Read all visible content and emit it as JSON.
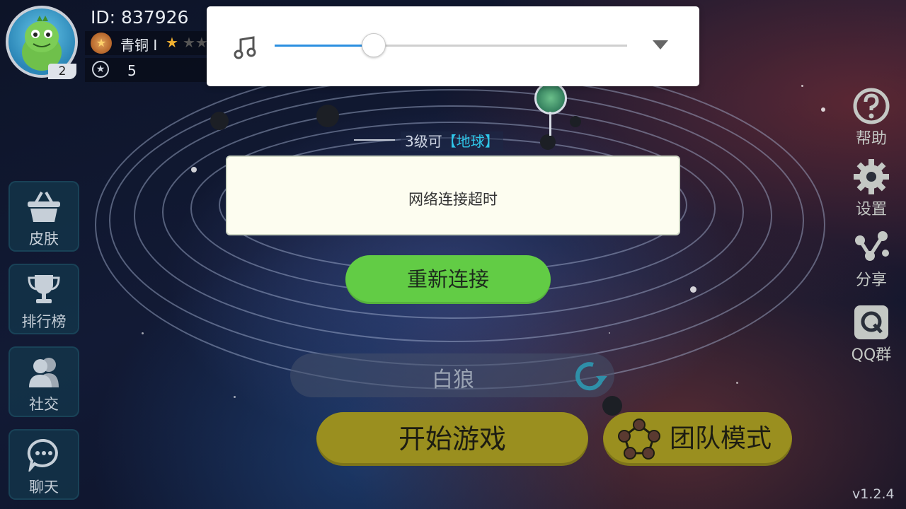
{
  "profile": {
    "id_text": "ID: 837926",
    "level_badge": "2",
    "rank_text": "青铜 I",
    "score": "5"
  },
  "music_panel": {
    "icon": "music-note-icon",
    "volume_percent": 28,
    "dropdown_icon": "triangle-down-icon"
  },
  "map": {
    "level_hint_prefix": "3级可",
    "level_hint_mid": "",
    "level_hint_planet": "【地球】"
  },
  "dialog": {
    "message": "网络连接超时",
    "reconnect_label": "重新连接"
  },
  "player_name": "白狼",
  "buttons": {
    "start_label": "开始游戏",
    "team_label": "团队模式"
  },
  "left_menu": [
    {
      "label": "皮肤",
      "icon": "basket-icon"
    },
    {
      "label": "排行榜",
      "icon": "trophy-icon"
    },
    {
      "label": "社交",
      "icon": "people-icon"
    },
    {
      "label": "聊天",
      "icon": "chat-icon"
    }
  ],
  "right_menu": [
    {
      "label": "帮助",
      "icon": "help-icon"
    },
    {
      "label": "设置",
      "icon": "gear-icon"
    },
    {
      "label": "分享",
      "icon": "share-icon"
    },
    {
      "label": "QQ群",
      "icon": "qq-icon"
    }
  ],
  "version": "v1.2.4",
  "colors": {
    "accent_green": "#62cc45",
    "button_olive": "#9a8f1f",
    "slider_blue": "#2b8fe0",
    "highlight_cyan": "#2fc6e8"
  }
}
